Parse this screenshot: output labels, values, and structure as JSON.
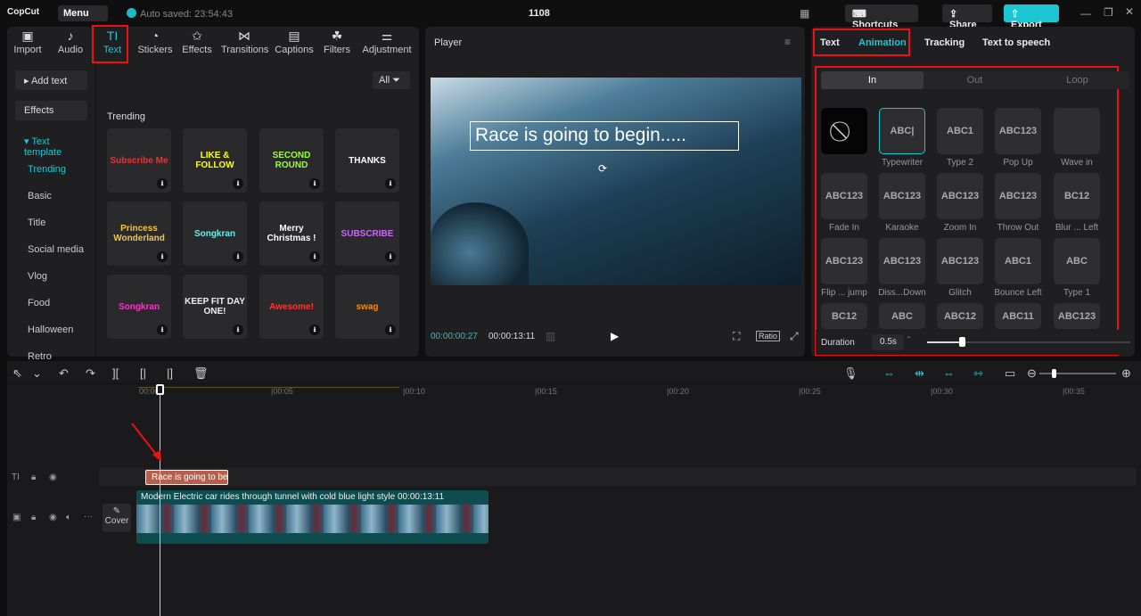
{
  "app": {
    "logo": "CopCut",
    "menu": "Menu",
    "auto_saved": "Auto saved: 23:54:43",
    "project_title": "1108",
    "shortcuts": "Shortcuts",
    "share": "Share",
    "export": "Export"
  },
  "toolbar": {
    "tabs": [
      {
        "label": "Import",
        "icon": "▣"
      },
      {
        "label": "Audio",
        "icon": "♪"
      },
      {
        "label": "Text",
        "icon": "TI"
      },
      {
        "label": "Stickers",
        "icon": "◔"
      },
      {
        "label": "Effects",
        "icon": "✩"
      },
      {
        "label": "Transitions",
        "icon": "⋈"
      },
      {
        "label": "Captions",
        "icon": "▤"
      },
      {
        "label": "Filters",
        "icon": "☘"
      },
      {
        "label": "Adjustment",
        "icon": "⚌"
      }
    ],
    "active": "Text"
  },
  "sidebar": {
    "add_text": "▸ Add text",
    "effects": "Effects",
    "text_template": "▾ Text template",
    "items": [
      "Trending",
      "Basic",
      "Title",
      "Social media",
      "Vlog",
      "Food",
      "Halloween",
      "Retro"
    ]
  },
  "library": {
    "filter": "All",
    "section": "Trending",
    "templates": [
      {
        "label": "Subscribe Me",
        "color": "#e33"
      },
      {
        "label": "LIKE & FOLLOW",
        "color": "#ff0"
      },
      {
        "label": "SECOND ROUND",
        "color": "#9f3"
      },
      {
        "label": "THANKS",
        "color": "#fff"
      },
      {
        "label": "Princess Wonderland",
        "color": "#f5c542"
      },
      {
        "label": "Songkran",
        "color": "#6ee"
      },
      {
        "label": "Merry Christmas !",
        "color": "#fff"
      },
      {
        "label": "SUBSCRIBE",
        "color": "#c6f"
      },
      {
        "label": "Songkran",
        "color": "#f3c"
      },
      {
        "label": "KEEP FIT DAY ONE!",
        "color": "#eee"
      },
      {
        "label": "Awesome!",
        "color": "#f33"
      },
      {
        "label": "swag",
        "color": "#f80"
      }
    ]
  },
  "player": {
    "title": "Player",
    "overlay_text": "Race is going to begin.....",
    "current_time": "00:00:00:27",
    "total_time": "00:00:13:11",
    "ratio": "Ratio"
  },
  "right_panel": {
    "tabs": [
      "Text",
      "Animation",
      "Tracking",
      "Text to speech"
    ],
    "active_tab": "Animation",
    "subtabs": [
      "In",
      "Out",
      "Loop"
    ],
    "active_subtab": "In",
    "animations": [
      {
        "label": "",
        "preview": "⃠"
      },
      {
        "label": "Typewriter",
        "preview": "ABC|",
        "selected": true
      },
      {
        "label": "Type 2",
        "preview": "ABC1"
      },
      {
        "label": "Pop Up",
        "preview": "ABC123"
      },
      {
        "label": "Wave in",
        "preview": ""
      },
      {
        "label": "Fade In",
        "preview": "ABC123"
      },
      {
        "label": "Karaoke",
        "preview": "ABC123"
      },
      {
        "label": "Zoom In",
        "preview": "ABC123"
      },
      {
        "label": "Throw Out",
        "preview": "ABC123"
      },
      {
        "label": "Blur ... Left",
        "preview": "BC12"
      },
      {
        "label": "Flip ... jump",
        "preview": "ABC123"
      },
      {
        "label": "Diss...Down",
        "preview": "ABC123"
      },
      {
        "label": "Glitch",
        "preview": "ABC123"
      },
      {
        "label": "Bounce Left",
        "preview": "ABC1"
      },
      {
        "label": "Type 1",
        "preview": "ABC"
      },
      {
        "label": "",
        "preview": "BC12"
      },
      {
        "label": "",
        "preview": "ABC"
      },
      {
        "label": "",
        "preview": "ABC12"
      },
      {
        "label": "",
        "preview": "ABC11"
      },
      {
        "label": "",
        "preview": "ABC123"
      }
    ],
    "duration_label": "Duration",
    "duration_value": "0.5s",
    "duration_fraction": 0.16
  },
  "timeline": {
    "ruler": [
      "00:00",
      "|00:05",
      "|00:10",
      "|00:15",
      "|00:20",
      "|00:25",
      "|00:30",
      "|00:35"
    ],
    "text_clip": "Race is going to be",
    "video_clip": "Modern Electric car rides through tunnel with cold blue light style",
    "video_duration": "00:00:13:11",
    "cover": "Cover"
  },
  "colors": {
    "accent": "#1ec5d2",
    "highlight": "#e11111",
    "text_clip": "#b5604f",
    "video_clip": "#0d4d4f"
  }
}
